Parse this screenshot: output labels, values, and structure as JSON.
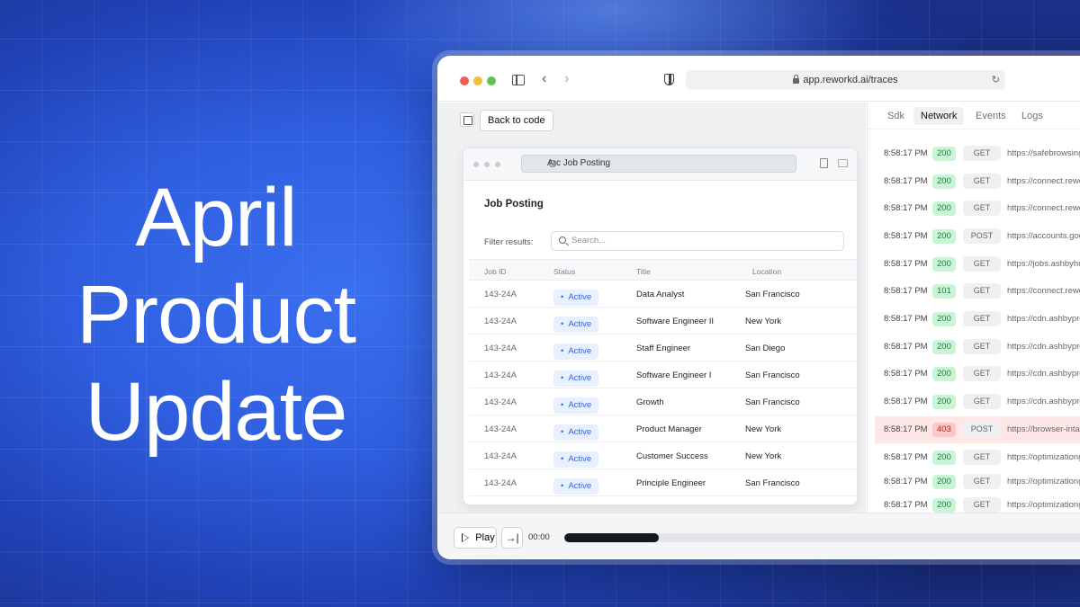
{
  "headline": {
    "line1": "April",
    "line2": "Product",
    "line3": "Update"
  },
  "browser": {
    "url": "app.reworkd.ai/traces",
    "back_to_code_label": "Back to code"
  },
  "inner_browser": {
    "tab_title": "Arc Job Posting",
    "page_title": "Job Posting",
    "filter_label": "Filter results:",
    "search_placeholder": "Search...",
    "columns": [
      "Job ID",
      "Status",
      "Title",
      "Location"
    ],
    "rows": [
      {
        "id": "143-24A",
        "status": "Active",
        "title": "Data Analyst",
        "location": "San Francisco"
      },
      {
        "id": "143-24A",
        "status": "Active",
        "title": "Software Engineer II",
        "location": "New York"
      },
      {
        "id": "143-24A",
        "status": "Active",
        "title": "Staff Engineer",
        "location": "San Diego"
      },
      {
        "id": "143-24A",
        "status": "Active",
        "title": "Software Engineer I",
        "location": "San Francisco"
      },
      {
        "id": "143-24A",
        "status": "Active",
        "title": "Growth",
        "location": "San Francisco"
      },
      {
        "id": "143-24A",
        "status": "Active",
        "title": "Product Manager",
        "location": "New York"
      },
      {
        "id": "143-24A",
        "status": "Active",
        "title": "Customer Success",
        "location": "New York"
      },
      {
        "id": "143-24A",
        "status": "Active",
        "title": "Principle Engineer",
        "location": "San Francisco"
      }
    ]
  },
  "devtools": {
    "tabs": [
      "Sdk",
      "Network",
      "Events",
      "Logs"
    ],
    "active_tab": "Network",
    "requests": [
      {
        "time": "8:58:17 PM",
        "status": "200",
        "method": "GET",
        "url": "https://safebrowsing"
      },
      {
        "time": "8:58:17 PM",
        "status": "200",
        "method": "GET",
        "url": "https://connect.rewo"
      },
      {
        "time": "8:58:17 PM",
        "status": "200",
        "method": "GET",
        "url": "https://connect.rewo"
      },
      {
        "time": "8:58:17 PM",
        "status": "200",
        "method": "POST",
        "url": "https://accounts.goo"
      },
      {
        "time": "8:58:17 PM",
        "status": "200",
        "method": "GET",
        "url": "https://jobs.ashbyhq"
      },
      {
        "time": "8:58:17 PM",
        "status": "101",
        "method": "GET",
        "url": "https://connect.rewo"
      },
      {
        "time": "8:58:17 PM",
        "status": "200",
        "method": "GET",
        "url": "https://cdn.ashbyprd"
      },
      {
        "time": "8:58:17 PM",
        "status": "200",
        "method": "GET",
        "url": "https://cdn.ashbyprd"
      },
      {
        "time": "8:58:17 PM",
        "status": "200",
        "method": "GET",
        "url": "https://cdn.ashbyprd"
      },
      {
        "time": "8:58:17 PM",
        "status": "200",
        "method": "GET",
        "url": "https://cdn.ashbyprd"
      },
      {
        "time": "8:58:17 PM",
        "status": "403",
        "method": "POST",
        "url": "https://browser-intak",
        "error": true
      },
      {
        "time": "8:58:17 PM",
        "status": "200",
        "method": "GET",
        "url": "https://optimizationg"
      },
      {
        "time": "8:58:17 PM",
        "status": "200",
        "method": "GET",
        "url": "https://optimizationg"
      },
      {
        "time": "8:58:17 PM",
        "status": "200",
        "method": "GET",
        "url": "https://optimizationg"
      }
    ]
  },
  "player": {
    "play_label": "Play",
    "skip_icon": "→|",
    "time": "00:00",
    "progress": 0.175
  },
  "colors": {
    "background": "#2f5fe0",
    "status_ok": "#c9f5d6",
    "status_error": "#fbc7c7",
    "active_badge": "#e8efff"
  },
  "icons": [
    "sidebar-icon",
    "chevron-left-icon",
    "chevron-right-icon",
    "shield-icon",
    "lock-icon",
    "reload-icon",
    "panel-toggle-icon",
    "globe-icon",
    "search-icon",
    "play-icon",
    "skip-end-icon"
  ]
}
